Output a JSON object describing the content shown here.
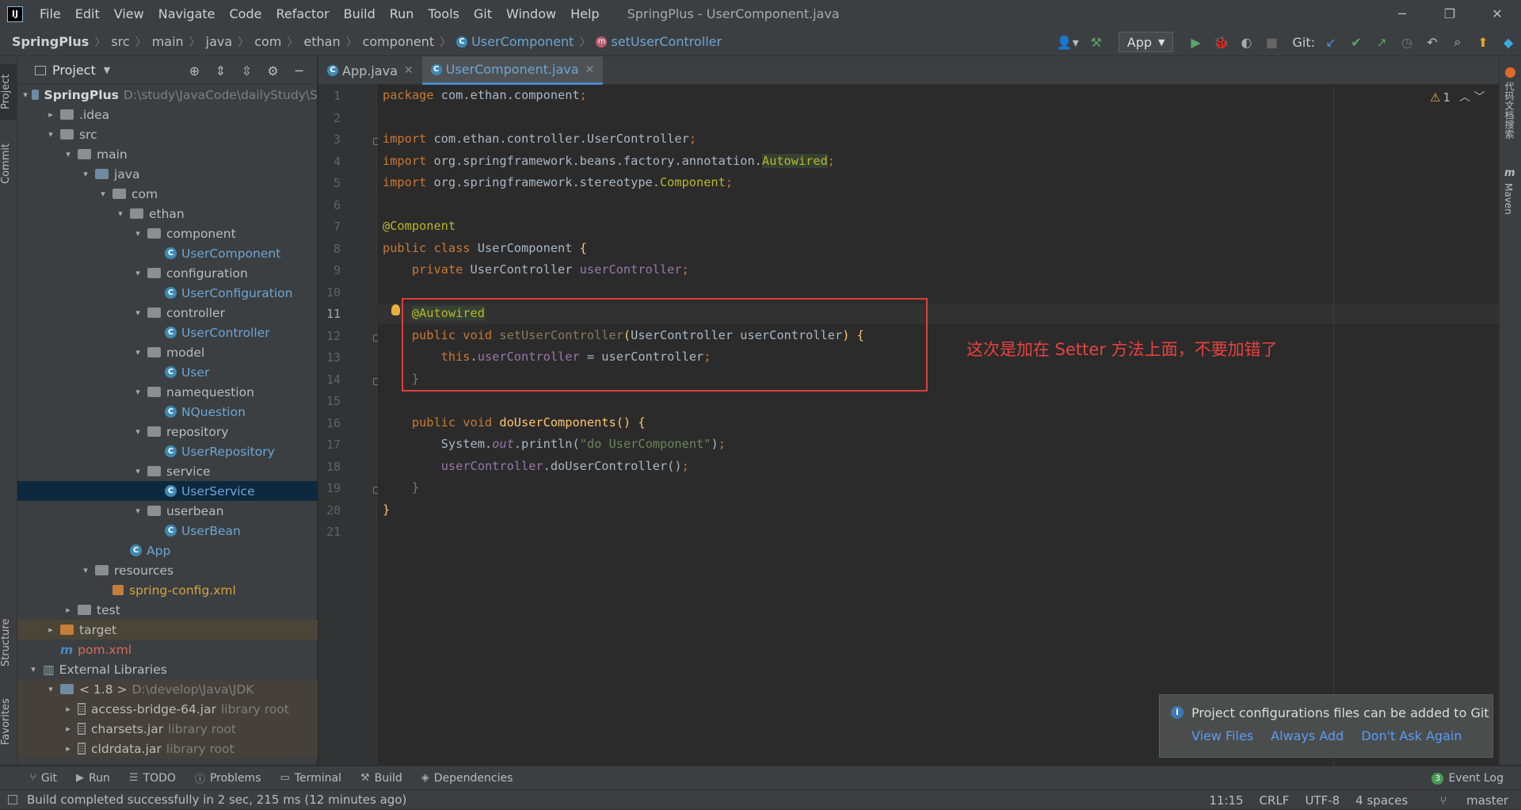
{
  "window": {
    "title": "SpringPlus - UserComponent.java",
    "menus": [
      "File",
      "Edit",
      "View",
      "Navigate",
      "Code",
      "Refactor",
      "Build",
      "Run",
      "Tools",
      "Git",
      "Window",
      "Help"
    ]
  },
  "navbar": {
    "breadcrumb": [
      "SpringPlus",
      "src",
      "main",
      "java",
      "com",
      "ethan",
      "component",
      "UserComponent",
      "setUserController"
    ],
    "run_config": "App",
    "git_label": "Git:"
  },
  "project_panel": {
    "title": "Project",
    "tree": [
      {
        "name": "SpringPlus",
        "extra": "D:\\study\\JavaCode\\dailyStudy\\S",
        "type": "module",
        "depth": 0,
        "expanded": true
      },
      {
        "name": ".idea",
        "type": "folder",
        "depth": 1,
        "expanded": false
      },
      {
        "name": "src",
        "type": "folder",
        "depth": 1,
        "expanded": true
      },
      {
        "name": "main",
        "type": "folder",
        "depth": 2,
        "expanded": true
      },
      {
        "name": "java",
        "type": "src",
        "depth": 3,
        "expanded": true
      },
      {
        "name": "com",
        "type": "pkg",
        "depth": 4,
        "expanded": true
      },
      {
        "name": "ethan",
        "type": "pkg",
        "depth": 5,
        "expanded": true
      },
      {
        "name": "component",
        "type": "pkg",
        "depth": 6,
        "expanded": true
      },
      {
        "name": "UserComponent",
        "type": "class",
        "depth": 7
      },
      {
        "name": "configuration",
        "type": "pkg",
        "depth": 6,
        "expanded": true
      },
      {
        "name": "UserConfiguration",
        "type": "class",
        "depth": 7
      },
      {
        "name": "controller",
        "type": "pkg",
        "depth": 6,
        "expanded": true
      },
      {
        "name": "UserController",
        "type": "class",
        "depth": 7
      },
      {
        "name": "model",
        "type": "pkg",
        "depth": 6,
        "expanded": true
      },
      {
        "name": "User",
        "type": "class",
        "depth": 7
      },
      {
        "name": "namequestion",
        "type": "pkg",
        "depth": 6,
        "expanded": true
      },
      {
        "name": "NQuestion",
        "type": "class",
        "depth": 7
      },
      {
        "name": "repository",
        "type": "pkg",
        "depth": 6,
        "expanded": true
      },
      {
        "name": "UserRepository",
        "type": "class",
        "depth": 7
      },
      {
        "name": "service",
        "type": "pkg",
        "depth": 6,
        "expanded": true
      },
      {
        "name": "UserService",
        "type": "class",
        "depth": 7,
        "selected": true
      },
      {
        "name": "userbean",
        "type": "pkg",
        "depth": 6,
        "expanded": true
      },
      {
        "name": "UserBean",
        "type": "class",
        "depth": 7
      },
      {
        "name": "App",
        "type": "class",
        "depth": 5
      },
      {
        "name": "resources",
        "type": "res",
        "depth": 3,
        "expanded": true
      },
      {
        "name": "spring-config.xml",
        "type": "xml",
        "depth": 4
      },
      {
        "name": "test",
        "type": "folder",
        "depth": 2,
        "expanded": false
      },
      {
        "name": "target",
        "type": "excluded",
        "depth": 1,
        "expanded": false
      },
      {
        "name": "pom.xml",
        "type": "pom",
        "depth": 1
      },
      {
        "name": "External Libraries",
        "type": "libs",
        "depth": 0,
        "expanded": true
      },
      {
        "name": "< 1.8 >",
        "extra": "D:\\develop\\Java\\JDK",
        "type": "sdk",
        "depth": 1,
        "expanded": true
      },
      {
        "name": "access-bridge-64.jar",
        "extra": "library root",
        "type": "jar",
        "depth": 2,
        "expanded": false
      },
      {
        "name": "charsets.jar",
        "extra": "library root",
        "type": "jar",
        "depth": 2,
        "expanded": false
      },
      {
        "name": "cldrdata.jar",
        "extra": "library root",
        "type": "jar",
        "depth": 2,
        "expanded": false
      }
    ]
  },
  "left_tabs": [
    "Project",
    "Commit",
    "Structure",
    "Favorites"
  ],
  "right_tabs": [
    "代码文档搜索",
    "Maven"
  ],
  "editor": {
    "tabs": [
      {
        "label": "App.java",
        "active": false
      },
      {
        "label": "UserComponent.java",
        "active": true
      }
    ],
    "current_line": 11,
    "warnings": "1",
    "lines": [
      [
        {
          "t": "package ",
          "c": "kw"
        },
        {
          "t": "com.ethan.component",
          "c": ""
        },
        {
          "t": ";",
          "c": "kw"
        }
      ],
      [],
      [
        {
          "t": "import ",
          "c": "kw"
        },
        {
          "t": "com.ethan.controller.UserController",
          "c": ""
        },
        {
          "t": ";",
          "c": "kw"
        }
      ],
      [
        {
          "t": "import ",
          "c": "kw"
        },
        {
          "t": "org.springframework.beans.factory.annotation.",
          "c": ""
        },
        {
          "t": "Autowired",
          "c": "an hl"
        },
        {
          "t": ";",
          "c": "kw"
        }
      ],
      [
        {
          "t": "import ",
          "c": "kw"
        },
        {
          "t": "org.springframework.stereotype.",
          "c": ""
        },
        {
          "t": "Component",
          "c": "an"
        },
        {
          "t": ";",
          "c": "kw"
        }
      ],
      [],
      [
        {
          "t": "@Component",
          "c": "an"
        }
      ],
      [
        {
          "t": "public class ",
          "c": "kw"
        },
        {
          "t": "UserComponent ",
          "c": ""
        },
        {
          "t": "{",
          "c": "mt"
        }
      ],
      [
        {
          "t": "    private ",
          "c": "kw"
        },
        {
          "t": "UserController ",
          "c": ""
        },
        {
          "t": "userController",
          "c": "fld"
        },
        {
          "t": ";",
          "c": "kw"
        }
      ],
      [],
      [
        {
          "t": "    ",
          "c": ""
        },
        {
          "t": "@Autowired",
          "c": "an hl"
        }
      ],
      [
        {
          "t": "    public void ",
          "c": "kw"
        },
        {
          "t": "setUserController",
          "c": "dim"
        },
        {
          "t": "(",
          "c": "mt"
        },
        {
          "t": "UserController userController",
          "c": ""
        },
        {
          "t": ") {",
          "c": "mt"
        }
      ],
      [
        {
          "t": "        this",
          "c": "kw"
        },
        {
          "t": ".",
          "c": ""
        },
        {
          "t": "userController",
          "c": "fld"
        },
        {
          "t": " = userController",
          "c": ""
        },
        {
          "t": ";",
          "c": "kw"
        }
      ],
      [
        {
          "t": "    }",
          "c": "str"
        }
      ],
      [],
      [
        {
          "t": "    public void ",
          "c": "kw"
        },
        {
          "t": "doUserComponents",
          "c": "mt"
        },
        {
          "t": "() {",
          "c": "mt"
        }
      ],
      [
        {
          "t": "        System.",
          "c": ""
        },
        {
          "t": "out",
          "c": "st"
        },
        {
          "t": ".println(",
          "c": ""
        },
        {
          "t": "\"do UserComponent\"",
          "c": "str"
        },
        {
          "t": ")",
          "c": ""
        },
        {
          "t": ";",
          "c": "kw"
        }
      ],
      [
        {
          "t": "        ",
          "c": ""
        },
        {
          "t": "userController",
          "c": "fld"
        },
        {
          "t": ".doUserController()",
          "c": ""
        },
        {
          "t": ";",
          "c": "kw"
        }
      ],
      [
        {
          "t": "    }",
          "c": "str"
        }
      ],
      [
        {
          "t": "}",
          "c": "mt"
        }
      ],
      []
    ],
    "annotation": "这次是加在 Setter 方法上面，不要加错了"
  },
  "notification": {
    "message": "Project configurations files can be added to Git",
    "links": [
      "View Files",
      "Always Add",
      "Don't Ask Again"
    ]
  },
  "bottom_tools": [
    "Git",
    "Run",
    "TODO",
    "Problems",
    "Terminal",
    "Build",
    "Dependencies"
  ],
  "event_log": {
    "label": "Event Log",
    "count": "3"
  },
  "status": {
    "message": "Build completed successfully in 2 sec, 215 ms (12 minutes ago)",
    "position": "11:15",
    "line_sep": "CRLF",
    "encoding": "UTF-8",
    "indent": "4 spaces",
    "branch": "master"
  }
}
